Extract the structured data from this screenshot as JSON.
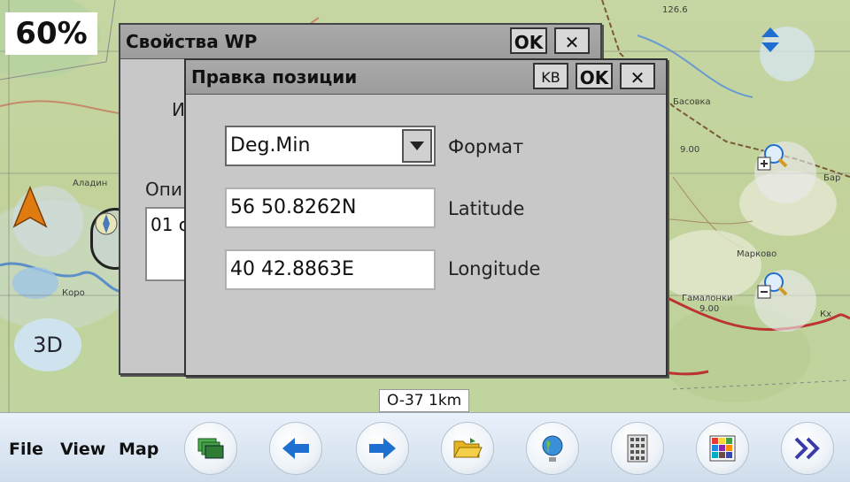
{
  "map": {
    "zoom_level": "60%",
    "mode_button": "3D",
    "scale": "O-37 1km",
    "labels": {
      "elev1": "126.6",
      "elev2": "9.00",
      "elev3": "9.00",
      "village1": "Аладин",
      "village2": "Марково",
      "village3": "Гамалонки",
      "village4": "Бар",
      "village5": "Кх",
      "village6": "Коро",
      "village7": "Басовка"
    }
  },
  "dialog_wp": {
    "title": "Свойства WP",
    "ok_label": "OK",
    "close_label": "✕",
    "name_label_partial": "И",
    "desc_label_partial": "Опи",
    "desc_value_partial": "01 с"
  },
  "dialog_position": {
    "title": "Правка позиции",
    "kb_label": "KB",
    "ok_label": "OK",
    "close_label": "✕",
    "format": {
      "label": "Формат",
      "value": "Deg.Min"
    },
    "latitude": {
      "label": "Latitude",
      "value": "56 50.8262N"
    },
    "longitude": {
      "label": "Longitude",
      "value": "40 42.8863E"
    }
  },
  "toolbar": {
    "menu": [
      "File",
      "View",
      "Map"
    ],
    "buttons": [
      "layers-icon",
      "arrow-left-icon",
      "arrow-right-icon",
      "folder-open-icon",
      "globe-icon",
      "calculator-icon",
      "grid-icon",
      "double-chevron-right-icon"
    ]
  },
  "colors": {
    "accent_arrow": "#1f6fd1",
    "nav_arrow": "#e07b12",
    "dialog_bg": "#c8c8c8"
  }
}
